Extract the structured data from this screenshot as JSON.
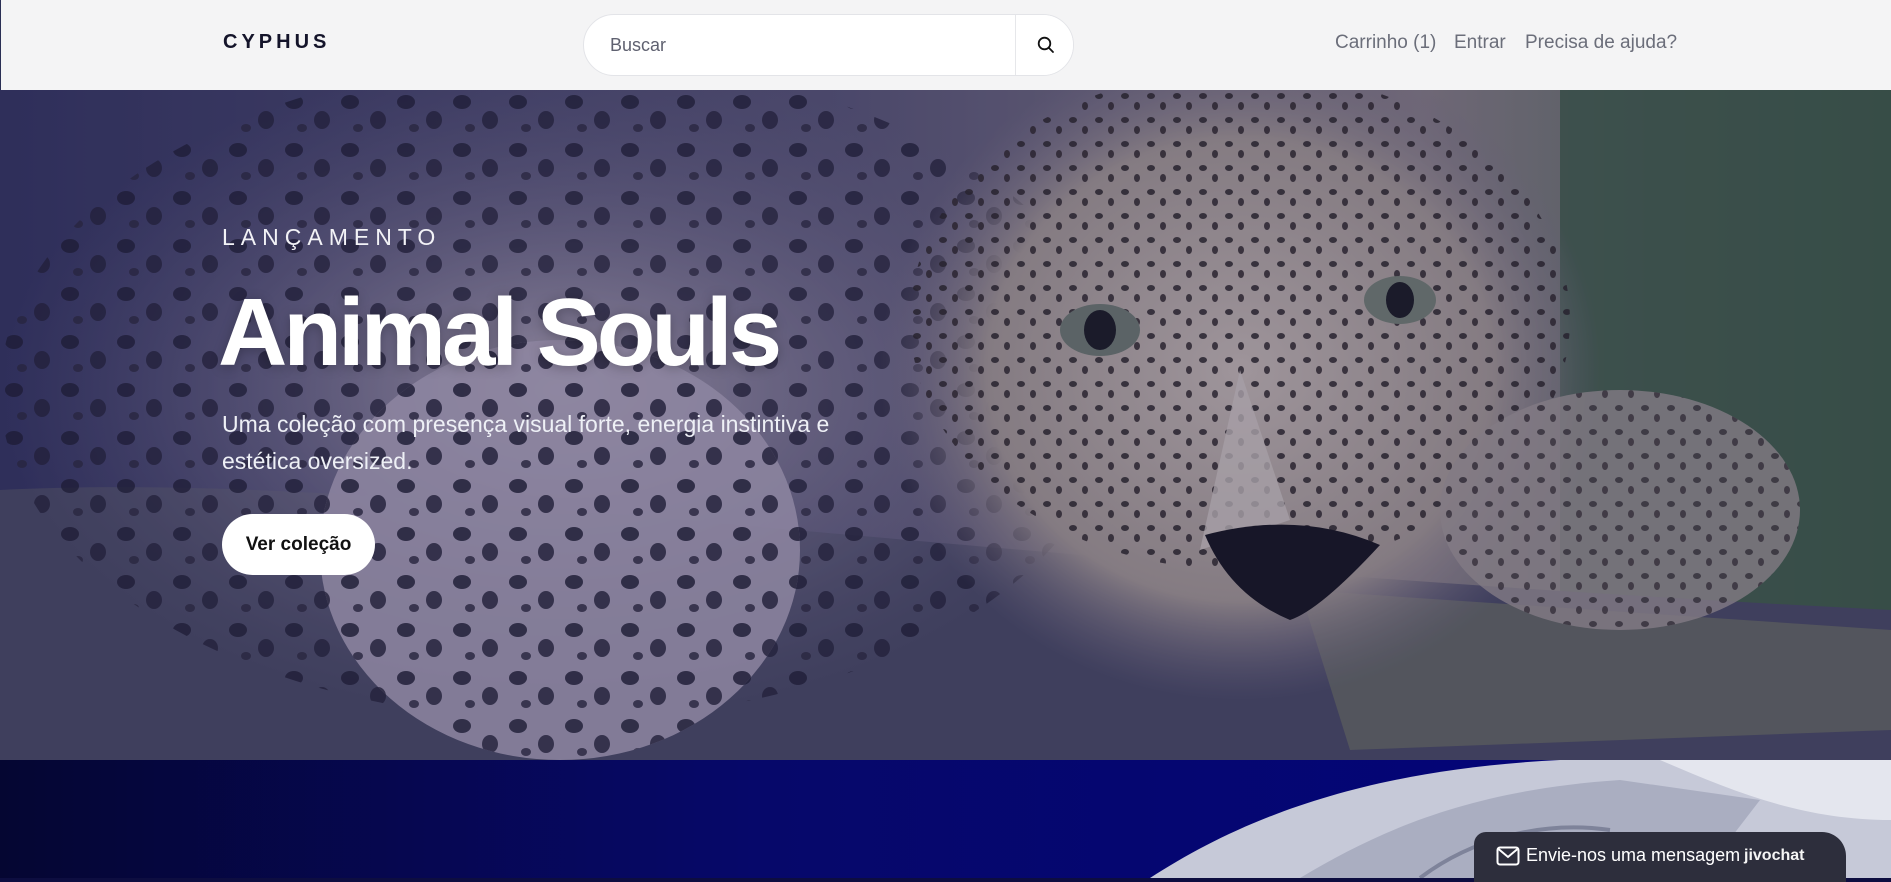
{
  "header": {
    "logo": "CYPHUS",
    "search": {
      "placeholder": "Buscar",
      "value": ""
    },
    "nav": {
      "cart": "Carrinho (1)",
      "login": "Entrar",
      "help": "Precisa de ajuda?"
    }
  },
  "hero": {
    "eyebrow": "LANÇAMENTO",
    "title": "Animal Souls",
    "subtitle": "Uma coleção com presença visual forte, energia instintiva e estética oversized.",
    "cta": "Ver coleção",
    "image": "leopard-photo"
  },
  "lower_section": {
    "image": "folded-shirt-photo"
  },
  "chat_widget": {
    "label": "Envie-nos uma mensagem",
    "brand": "jivochat",
    "icon": "mail-icon"
  },
  "colors": {
    "header_bg": "#f4f4f5",
    "hero_overlay": "#1e1e5a",
    "lower_bg": "#03037d",
    "chat_bg": "#2d2e3c",
    "cta_bg": "#ffffff"
  }
}
